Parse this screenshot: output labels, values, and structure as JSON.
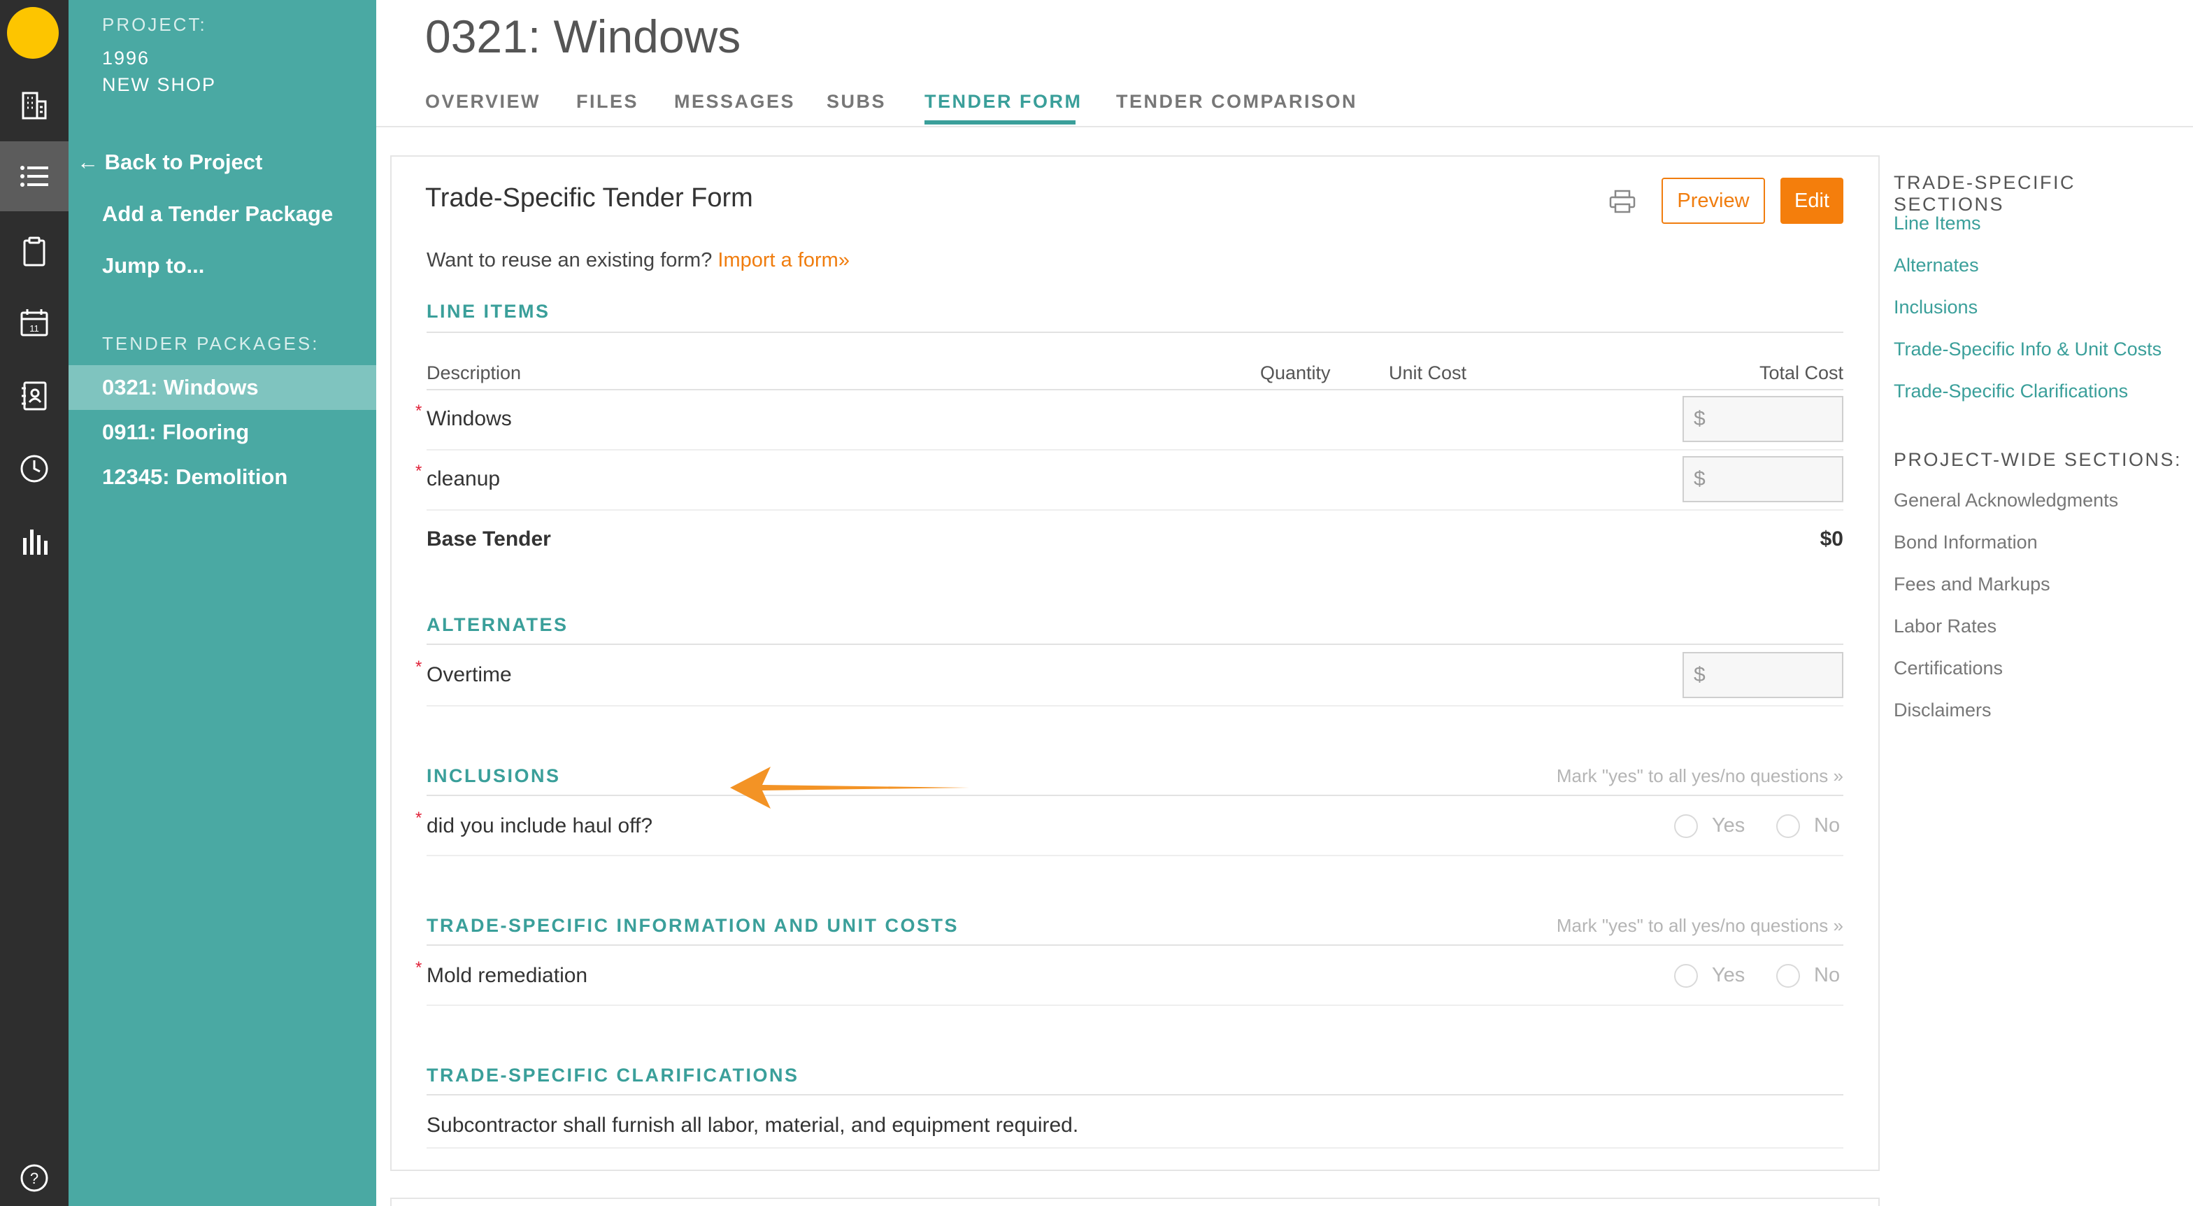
{
  "rail": {
    "icons": [
      "building-icon",
      "list-icon",
      "clipboard-icon",
      "calendar-icon",
      "address-book-icon",
      "clock-icon",
      "bar-chart-icon",
      "help-icon"
    ],
    "calendar_day": "11",
    "help_glyph": "?"
  },
  "sidebar": {
    "project_label": "PROJECT:",
    "project_number": "1996",
    "project_name": "NEW SHOP",
    "back_arrow": "←",
    "back_label": "Back to Project",
    "add_package": "Add a Tender Package",
    "jump_to": "Jump to...",
    "packages_label": "TENDER PACKAGES:",
    "packages": [
      "0321: Windows",
      "0911: Flooring",
      "12345: Demolition"
    ],
    "active_package": 0
  },
  "header": {
    "title": "0321: Windows",
    "tabs": [
      "OVERVIEW",
      "FILES",
      "MESSAGES",
      "SUBS",
      "TENDER FORM",
      "TENDER COMPARISON"
    ],
    "active_tab": 4
  },
  "form": {
    "title": "Trade-Specific Tender Form",
    "preview_label": "Preview",
    "edit_label": "Edit",
    "reuse_text": "Want to reuse an existing form?",
    "import_link": "Import a form»",
    "line_items": {
      "heading": "LINE ITEMS",
      "columns": [
        "Description",
        "Quantity",
        "Unit Cost",
        "Total Cost"
      ],
      "rows": [
        {
          "description": "Windows",
          "currency": "$"
        },
        {
          "description": "cleanup",
          "currency": "$"
        }
      ],
      "base_label": "Base Tender",
      "base_value": "$0"
    },
    "alternates": {
      "heading": "ALTERNATES",
      "rows": [
        {
          "description": "Overtime",
          "currency": "$"
        }
      ]
    },
    "inclusions": {
      "heading": "INCLUSIONS",
      "mark_all": "Mark \"yes\" to all yes/no questions »",
      "rows": [
        {
          "question": "did you include haul off?"
        }
      ]
    },
    "trade_info": {
      "heading": "TRADE-SPECIFIC INFORMATION AND UNIT COSTS",
      "mark_all": "Mark \"yes\" to all yes/no questions »",
      "rows": [
        {
          "question": "Mold remediation"
        }
      ]
    },
    "clarifications": {
      "heading": "TRADE-SPECIFIC CLARIFICATIONS",
      "text": "Subcontractor shall furnish all labor, material, and equipment required."
    },
    "yes_label": "Yes",
    "no_label": "No",
    "required_mark": "*"
  },
  "right_nav": {
    "trade_heading": "TRADE-SPECIFIC SECTIONS",
    "trade_links": [
      "Line Items",
      "Alternates",
      "Inclusions",
      "Trade-Specific Info & Unit Costs",
      "Trade-Specific Clarifications"
    ],
    "project_heading": "PROJECT-WIDE SECTIONS:",
    "project_links": [
      "General Acknowledgments",
      "Bond Information",
      "Fees and Markups",
      "Labor Rates",
      "Certifications",
      "Disclaimers"
    ]
  },
  "colors": {
    "teal": "#4aa9a3",
    "accent": "#3a9f9a",
    "orange": "#f07d0f",
    "rail": "#2e2e2e",
    "logo": "#fdc500",
    "required": "#e0233a"
  },
  "annotation": {
    "type": "arrow-left",
    "color": "#f39325"
  }
}
